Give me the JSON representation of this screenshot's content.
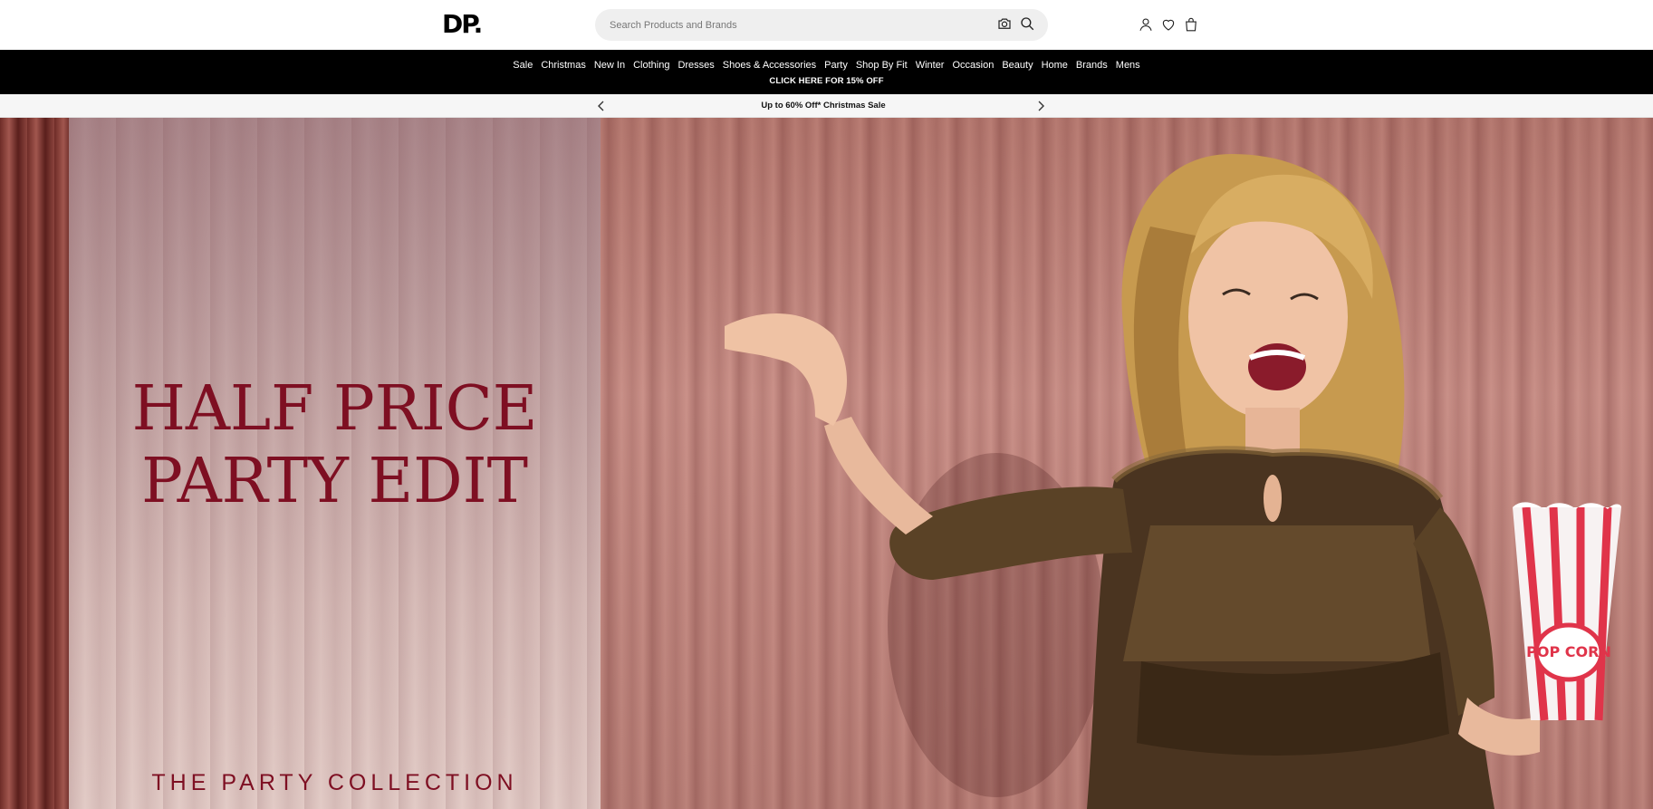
{
  "header": {
    "logo": "DP.",
    "search_placeholder": "Search Products and Brands",
    "icons": [
      "camera-icon",
      "search-icon",
      "account-icon",
      "heart-icon",
      "bag-icon"
    ]
  },
  "nav": {
    "items": [
      "Sale",
      "Christmas",
      "New In",
      "Clothing",
      "Dresses",
      "Shoes & Accessories",
      "Party",
      "Shop By Fit",
      "Winter",
      "Occasion",
      "Beauty",
      "Home",
      "Brands",
      "Mens"
    ],
    "promo": "CLICK HERE FOR 15% OFF"
  },
  "announcement": {
    "text": "Up to 60% Off* Christmas Sale"
  },
  "hero": {
    "title_line1": "HALF PRICE",
    "title_line2": "PARTY EDIT",
    "subtitle": "THE PARTY COLLECTION",
    "popcorn_text": "POP CORN"
  },
  "colors": {
    "nav_bg": "#000000",
    "hero_text": "#7e0f22",
    "search_bg": "#efefef"
  }
}
